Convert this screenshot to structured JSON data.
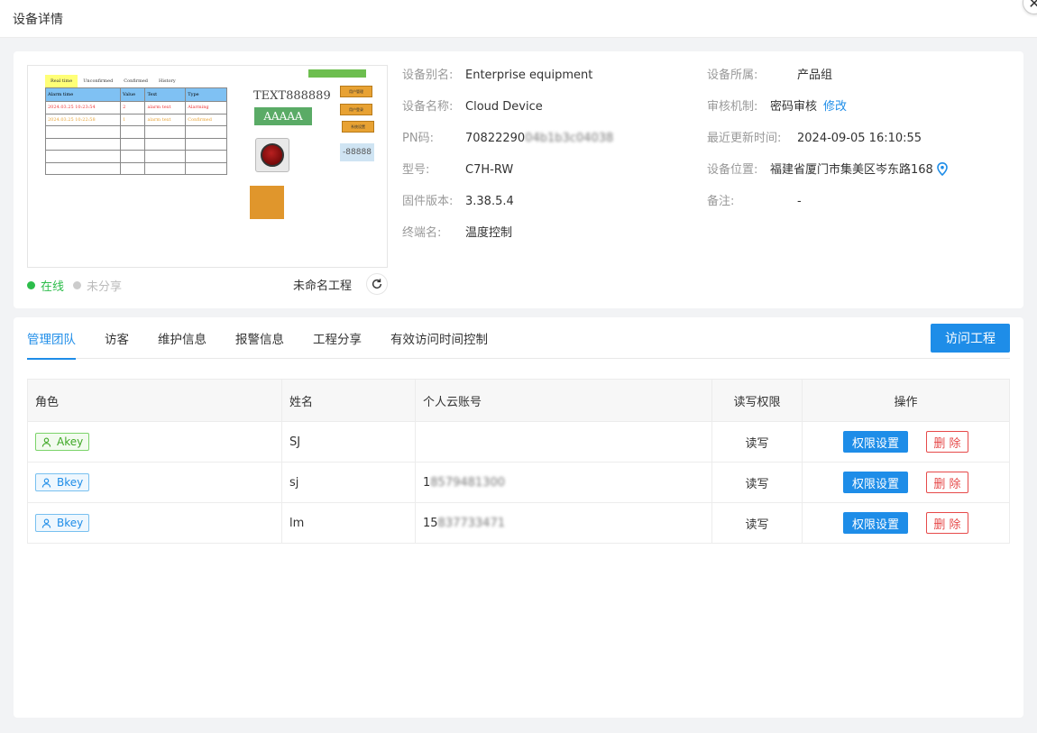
{
  "modal": {
    "title": "设备详情",
    "close_label": "✕"
  },
  "preview": {
    "tabs": [
      "Real time",
      "Unconfirmed",
      "Confirmed",
      "History"
    ],
    "table_headers": [
      "Alarm time",
      "Value",
      "Text",
      "Type"
    ],
    "table_rows": [
      [
        "2024.03.25 10:23:54",
        "2",
        "alarm text",
        "Alarming"
      ],
      [
        "2024.03.25 10:22:58",
        "1",
        "alarm text",
        "Confirmed"
      ]
    ],
    "text_label": "TEXT888889",
    "green_button": "AAAAA",
    "buttons": [
      "用户管理",
      "用户登录",
      "系统设置"
    ],
    "number_display": "-88888"
  },
  "status": {
    "online": "在线",
    "unshared": "未分享",
    "project_name": "未命名工程"
  },
  "info_left": [
    {
      "label": "设备别名:",
      "value": "Enterprise equipment"
    },
    {
      "label": "设备名称:",
      "value": "Cloud Device"
    },
    {
      "label": "PN码:",
      "value": "70822290",
      "blurred": "04b1b3c04038"
    },
    {
      "label": "型号:",
      "value": "C7H-RW"
    },
    {
      "label": "固件版本:",
      "value": "3.38.5.4"
    },
    {
      "label": "终端名:",
      "value": "温度控制"
    }
  ],
  "info_right": [
    {
      "label": "设备所属:",
      "value": "产品组"
    },
    {
      "label": "审核机制:",
      "value": "密码审核",
      "link": "修改"
    },
    {
      "label": "最近更新时间:",
      "value": "2024-09-05 16:10:55"
    },
    {
      "label": "设备位置:",
      "value": "福建省厦门市集美区岑东路168"
    },
    {
      "label": "备注:",
      "value": "-"
    }
  ],
  "tabs": [
    "管理团队",
    "访客",
    "维护信息",
    "报警信息",
    "工程分享",
    "有效访问时间控制"
  ],
  "visit_button": "访问工程",
  "table": {
    "headers": [
      "角色",
      "姓名",
      "个人云账号",
      "读写权限",
      "操作"
    ],
    "rows": [
      {
        "role": "Akey",
        "name": "SJ",
        "account": "",
        "account_blur": "",
        "permission": "读写",
        "perm_btn": "权限设置",
        "del_btn": "删 除"
      },
      {
        "role": "Bkey",
        "name": "sj",
        "account": "1",
        "account_blur": "8579481300",
        "permission": "读写",
        "perm_btn": "权限设置",
        "del_btn": "删 除"
      },
      {
        "role": "Bkey",
        "name": "lm",
        "account": "15",
        "account_blur": "837733471",
        "permission": "读写",
        "perm_btn": "权限设置",
        "del_btn": "删 除"
      }
    ]
  },
  "colors": {
    "primary": "#1e8de8",
    "online": "#2dbd4b",
    "danger": "#e64a4a"
  }
}
